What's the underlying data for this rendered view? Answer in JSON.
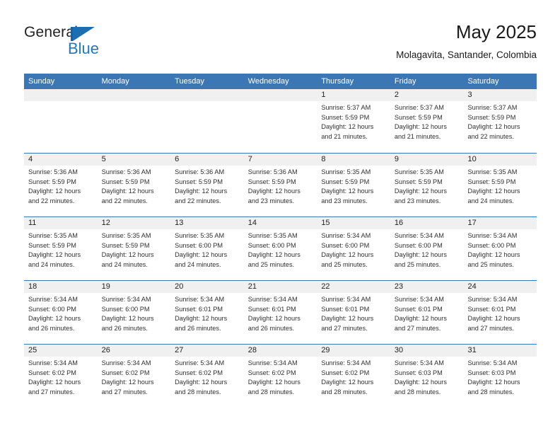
{
  "brand": {
    "word_general": "General",
    "word_blue": "Blue",
    "flag_color": "#1b6eb0",
    "blue_text_color": "#1d7ac4"
  },
  "header": {
    "title": "May 2025",
    "subtitle": "Molagavita, Santander, Colombia",
    "accent_color": "#3b77b5",
    "day_strip_color": "#f0f0f0"
  },
  "weekdays": [
    "Sunday",
    "Monday",
    "Tuesday",
    "Wednesday",
    "Thursday",
    "Friday",
    "Saturday"
  ],
  "weeks": [
    [
      {
        "day": "",
        "lines": []
      },
      {
        "day": "",
        "lines": []
      },
      {
        "day": "",
        "lines": []
      },
      {
        "day": "",
        "lines": []
      },
      {
        "day": "1",
        "lines": [
          "Sunrise: 5:37 AM",
          "Sunset: 5:59 PM",
          "Daylight: 12 hours",
          "and 21 minutes."
        ]
      },
      {
        "day": "2",
        "lines": [
          "Sunrise: 5:37 AM",
          "Sunset: 5:59 PM",
          "Daylight: 12 hours",
          "and 21 minutes."
        ]
      },
      {
        "day": "3",
        "lines": [
          "Sunrise: 5:37 AM",
          "Sunset: 5:59 PM",
          "Daylight: 12 hours",
          "and 22 minutes."
        ]
      }
    ],
    [
      {
        "day": "4",
        "lines": [
          "Sunrise: 5:36 AM",
          "Sunset: 5:59 PM",
          "Daylight: 12 hours",
          "and 22 minutes."
        ]
      },
      {
        "day": "5",
        "lines": [
          "Sunrise: 5:36 AM",
          "Sunset: 5:59 PM",
          "Daylight: 12 hours",
          "and 22 minutes."
        ]
      },
      {
        "day": "6",
        "lines": [
          "Sunrise: 5:36 AM",
          "Sunset: 5:59 PM",
          "Daylight: 12 hours",
          "and 22 minutes."
        ]
      },
      {
        "day": "7",
        "lines": [
          "Sunrise: 5:36 AM",
          "Sunset: 5:59 PM",
          "Daylight: 12 hours",
          "and 23 minutes."
        ]
      },
      {
        "day": "8",
        "lines": [
          "Sunrise: 5:35 AM",
          "Sunset: 5:59 PM",
          "Daylight: 12 hours",
          "and 23 minutes."
        ]
      },
      {
        "day": "9",
        "lines": [
          "Sunrise: 5:35 AM",
          "Sunset: 5:59 PM",
          "Daylight: 12 hours",
          "and 23 minutes."
        ]
      },
      {
        "day": "10",
        "lines": [
          "Sunrise: 5:35 AM",
          "Sunset: 5:59 PM",
          "Daylight: 12 hours",
          "and 24 minutes."
        ]
      }
    ],
    [
      {
        "day": "11",
        "lines": [
          "Sunrise: 5:35 AM",
          "Sunset: 5:59 PM",
          "Daylight: 12 hours",
          "and 24 minutes."
        ]
      },
      {
        "day": "12",
        "lines": [
          "Sunrise: 5:35 AM",
          "Sunset: 5:59 PM",
          "Daylight: 12 hours",
          "and 24 minutes."
        ]
      },
      {
        "day": "13",
        "lines": [
          "Sunrise: 5:35 AM",
          "Sunset: 6:00 PM",
          "Daylight: 12 hours",
          "and 24 minutes."
        ]
      },
      {
        "day": "14",
        "lines": [
          "Sunrise: 5:35 AM",
          "Sunset: 6:00 PM",
          "Daylight: 12 hours",
          "and 25 minutes."
        ]
      },
      {
        "day": "15",
        "lines": [
          "Sunrise: 5:34 AM",
          "Sunset: 6:00 PM",
          "Daylight: 12 hours",
          "and 25 minutes."
        ]
      },
      {
        "day": "16",
        "lines": [
          "Sunrise: 5:34 AM",
          "Sunset: 6:00 PM",
          "Daylight: 12 hours",
          "and 25 minutes."
        ]
      },
      {
        "day": "17",
        "lines": [
          "Sunrise: 5:34 AM",
          "Sunset: 6:00 PM",
          "Daylight: 12 hours",
          "and 25 minutes."
        ]
      }
    ],
    [
      {
        "day": "18",
        "lines": [
          "Sunrise: 5:34 AM",
          "Sunset: 6:00 PM",
          "Daylight: 12 hours",
          "and 26 minutes."
        ]
      },
      {
        "day": "19",
        "lines": [
          "Sunrise: 5:34 AM",
          "Sunset: 6:00 PM",
          "Daylight: 12 hours",
          "and 26 minutes."
        ]
      },
      {
        "day": "20",
        "lines": [
          "Sunrise: 5:34 AM",
          "Sunset: 6:01 PM",
          "Daylight: 12 hours",
          "and 26 minutes."
        ]
      },
      {
        "day": "21",
        "lines": [
          "Sunrise: 5:34 AM",
          "Sunset: 6:01 PM",
          "Daylight: 12 hours",
          "and 26 minutes."
        ]
      },
      {
        "day": "22",
        "lines": [
          "Sunrise: 5:34 AM",
          "Sunset: 6:01 PM",
          "Daylight: 12 hours",
          "and 27 minutes."
        ]
      },
      {
        "day": "23",
        "lines": [
          "Sunrise: 5:34 AM",
          "Sunset: 6:01 PM",
          "Daylight: 12 hours",
          "and 27 minutes."
        ]
      },
      {
        "day": "24",
        "lines": [
          "Sunrise: 5:34 AM",
          "Sunset: 6:01 PM",
          "Daylight: 12 hours",
          "and 27 minutes."
        ]
      }
    ],
    [
      {
        "day": "25",
        "lines": [
          "Sunrise: 5:34 AM",
          "Sunset: 6:02 PM",
          "Daylight: 12 hours",
          "and 27 minutes."
        ]
      },
      {
        "day": "26",
        "lines": [
          "Sunrise: 5:34 AM",
          "Sunset: 6:02 PM",
          "Daylight: 12 hours",
          "and 27 minutes."
        ]
      },
      {
        "day": "27",
        "lines": [
          "Sunrise: 5:34 AM",
          "Sunset: 6:02 PM",
          "Daylight: 12 hours",
          "and 28 minutes."
        ]
      },
      {
        "day": "28",
        "lines": [
          "Sunrise: 5:34 AM",
          "Sunset: 6:02 PM",
          "Daylight: 12 hours",
          "and 28 minutes."
        ]
      },
      {
        "day": "29",
        "lines": [
          "Sunrise: 5:34 AM",
          "Sunset: 6:02 PM",
          "Daylight: 12 hours",
          "and 28 minutes."
        ]
      },
      {
        "day": "30",
        "lines": [
          "Sunrise: 5:34 AM",
          "Sunset: 6:03 PM",
          "Daylight: 12 hours",
          "and 28 minutes."
        ]
      },
      {
        "day": "31",
        "lines": [
          "Sunrise: 5:34 AM",
          "Sunset: 6:03 PM",
          "Daylight: 12 hours",
          "and 28 minutes."
        ]
      }
    ]
  ]
}
